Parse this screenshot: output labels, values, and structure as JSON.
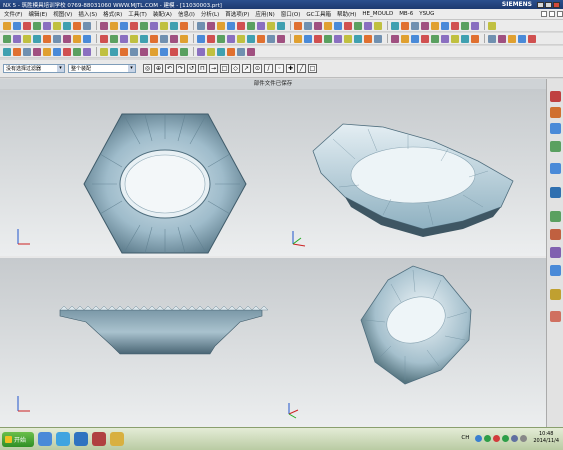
{
  "window": {
    "title_left": "NX 5 - 筑胜模具培训学校  0769-88031060  WWW.MJTL.COM - 建模 - [11030003.prt]",
    "brand": "SIEMENS"
  },
  "menu": {
    "items": [
      "文件(F)",
      "编辑(E)",
      "视图(V)",
      "插入(S)",
      "格式(R)",
      "工具(T)",
      "装配(A)",
      "信息(I)",
      "分析(L)",
      "首选项(P)",
      "应用(N)",
      "窗口(O)",
      "GC工具箱",
      "帮助(H)",
      "HE_MOULD",
      "MB-6",
      "YSUG"
    ]
  },
  "selection": {
    "filter_value": "没有选择过滤器",
    "scope_value": "整个装配"
  },
  "viewport": {
    "status_text": "部件文件已保存",
    "axes_label_x": "X",
    "axes_label_y": "Y",
    "axes_label_z": "Z"
  },
  "taskbar": {
    "start_label": "开始",
    "lang_label": "CH",
    "clock_time": "10:48",
    "clock_date": "2014/11/4"
  },
  "colors": {
    "model": "#8fb1c1",
    "model_dark": "#4f6e7e",
    "viewport_bg": "#cfd3d6",
    "title_bg": "#1d3a70"
  },
  "icons": {
    "toolbar": [
      "new-icon",
      "open-icon",
      "save-icon",
      "cut-icon",
      "copy-icon",
      "paste-icon",
      "undo-icon",
      "redo-icon",
      "sketch-icon",
      "extrude-icon",
      "revolve-icon",
      "hole-icon",
      "blend-icon",
      "chamfer-icon",
      "shell-icon",
      "view-icon"
    ],
    "resource_bar": [
      "assembly-navigator-icon",
      "part-navigator-icon",
      "reuse-library-icon",
      "web-browser-icon",
      "history-icon",
      "system-materials-icon",
      "process-studio-icon",
      "roles-icon"
    ]
  }
}
